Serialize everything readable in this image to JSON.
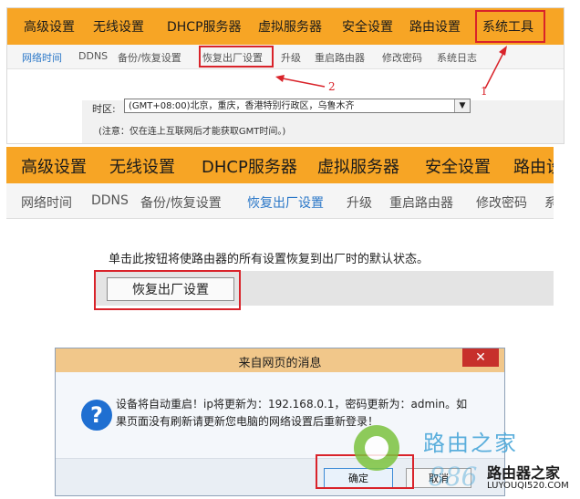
{
  "nav": [
    "高级设置",
    "无线设置",
    "DHCP服务器",
    "虚拟服务器",
    "安全设置",
    "路由设置",
    "系统工具"
  ],
  "nav_zoom": [
    "高级设置",
    "无线设置",
    "DHCP服务器",
    "虚拟服务器",
    "安全设置",
    "路由设"
  ],
  "subnav": [
    "网络时间",
    "DDNS",
    "备份/恢复设置",
    "恢复出厂设置",
    "升级",
    "重启路由器",
    "修改密码",
    "系统日志"
  ],
  "subnav_zoom": [
    "网络时间",
    "DDNS",
    "备份/恢复设置",
    "恢复出厂设置",
    "升级",
    "重启路由器",
    "修改密码",
    "系"
  ],
  "timezone": {
    "label": "时区:",
    "value": "(GMT+08:00)北京，重庆，香港特别行政区，乌鲁木齐",
    "arrow": "▼",
    "note": "(注意：仅在连上互联网后才能获取GMT时间。)"
  },
  "callouts": [
    "1",
    "2"
  ],
  "reset": {
    "description": "单击此按钮将使路由器的所有设置恢复到出厂时的默认状态。",
    "button": "恢复出厂设置"
  },
  "dialog": {
    "title": "来自网页的消息",
    "close": "✕",
    "icon": "?",
    "message": "设备将自动重启！ip将更新为：192.168.0.1，密码更新为：admin。如果页面没有刷新请更新您电脑的网络设置后重新登录！",
    "ok": "确定",
    "cancel": "取消"
  },
  "watermark": {
    "text": "路由之家",
    "num": "886",
    "brand": "路由器之家",
    "url": "LUYOUQI520.COM"
  },
  "colors": {
    "nav_bg": "#f7a525",
    "accent_red": "#d9232a",
    "active_link": "#2c78c8"
  }
}
